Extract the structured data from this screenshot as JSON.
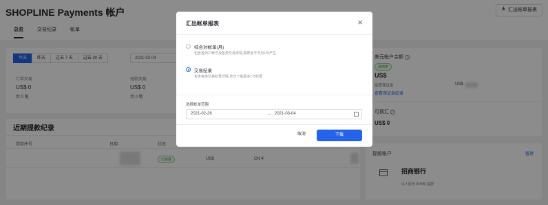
{
  "header": {
    "title": "SHOPLINE Payments 帐户",
    "export_label": "汇出帐单报表",
    "export_icon": "download-icon",
    "tabs": [
      {
        "label": "总览",
        "active": true
      },
      {
        "label": "交易纪录",
        "active": false
      },
      {
        "label": "帐单",
        "active": false
      }
    ]
  },
  "summary": {
    "ranges": [
      {
        "label": "今天",
        "active": true
      },
      {
        "label": "昨天",
        "active": false
      },
      {
        "label": "过去 7 天",
        "active": false
      },
      {
        "label": "过去 30 天",
        "active": false
      }
    ],
    "date_start": "2021-03-04",
    "orders": {
      "label": "订单交易",
      "amount": "US$ 0",
      "count": "共 0 笔"
    },
    "refunds": {
      "label": "退款交易",
      "amount": "US$ 0",
      "count": "共 0 笔"
    }
  },
  "recent": {
    "title": "近期提款纪录",
    "columns": [
      "提款序号",
      "日期",
      "状态"
    ],
    "row": {
      "status": "已完成",
      "currency": "US$",
      "currency2": "CN ¥"
    }
  },
  "usd_account": {
    "label": "美元帐户余额",
    "badge": "启用中",
    "amount": "US$",
    "reserve_label": "监管保证金",
    "reserve_value": "US$",
    "link": "查看保证金纪录",
    "fx_label": "可换汇",
    "fx_amount": "US$ 0"
  },
  "withdraw_account": {
    "title": "提款帐户",
    "manage": "管理",
    "bank_name": "招商银行",
    "bank_sub": "以人民币 (RMB) 提款"
  },
  "modal": {
    "title": "汇出帐单报表",
    "options": [
      {
        "label": "综合对帐单(月)",
        "desc": "包含各商户帐号及各类交易详情,报表会于次月1日产生",
        "checked": false
      },
      {
        "label": "交易纪录",
        "desc": "包含各类交易纪录详情,单次下载最多7日纪录",
        "checked": true
      }
    ],
    "range_label": "选择帐单范围",
    "range_start": "2021-02-26",
    "range_end": "2021-03-04",
    "cancel": "取消",
    "download": "下载"
  },
  "colors": {
    "accent": "#2563e8",
    "success": "#2f9e44",
    "overlay": "rgba(0,0,0,0.45)"
  }
}
